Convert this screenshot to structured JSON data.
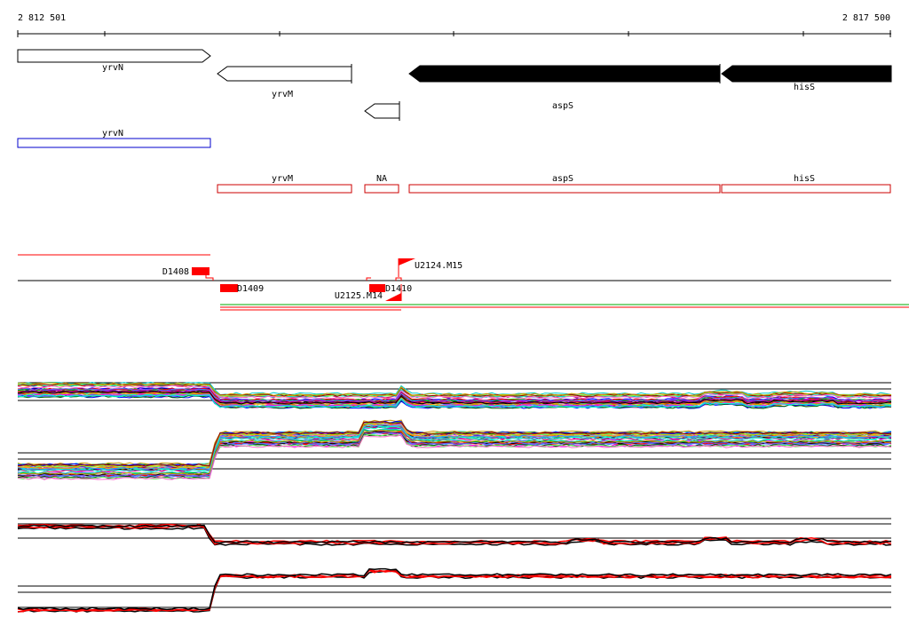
{
  "axis": {
    "start_label": "2 812 501",
    "end_label": "2 817 500"
  },
  "genes_strand_track": [
    {
      "name": "yrvN",
      "direction": "forward",
      "style": "outline",
      "label": "yrvN"
    },
    {
      "name": "yrvM",
      "direction": "reverse",
      "style": "outline",
      "label": "yrvM"
    },
    {
      "name": "small-orf",
      "direction": "reverse",
      "style": "outline",
      "label": ""
    },
    {
      "name": "aspS",
      "direction": "reverse",
      "style": "filled",
      "label": "aspS"
    },
    {
      "name": "hisS",
      "direction": "reverse",
      "style": "filled",
      "label": "hisS"
    }
  ],
  "annotation_track_blue": [
    {
      "label": "yrvN"
    }
  ],
  "annotation_track_red": [
    {
      "label": "yrvM"
    },
    {
      "label": "NA"
    },
    {
      "label": "aspS"
    },
    {
      "label": "hisS"
    }
  ],
  "features": {
    "D1408": "D1408",
    "D1409": "D1409",
    "D1410": "D1410",
    "U2124": "U2124.M15",
    "U2125": "U2125.M14"
  },
  "colors": {
    "feature_red": "#ff0000",
    "annotation_blue": "#0000cc",
    "annotation_red": "#cc0000",
    "gene_filled": "#000000",
    "line_green": "#00aa00"
  }
}
